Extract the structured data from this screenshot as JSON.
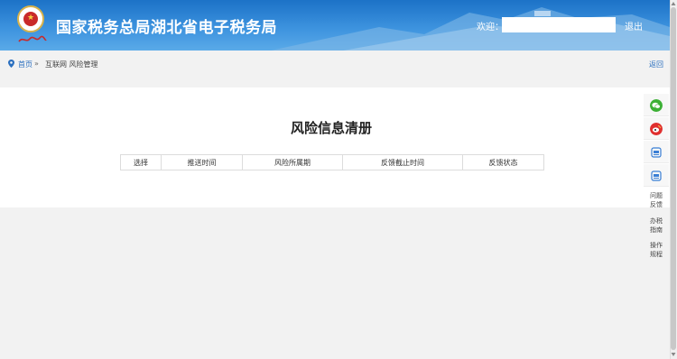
{
  "header": {
    "title": "国家税务总局湖北省电子税务局",
    "welcome_label": "欢迎：",
    "logout_label": "退出",
    "emblem_text": "中国税务"
  },
  "breadcrumb": {
    "home_label": "首页",
    "separator": "»",
    "current": "互联网 风险管理",
    "back_label": "返回"
  },
  "main": {
    "title": "风险信息清册",
    "table": {
      "columns": [
        "选择",
        "推送时间",
        "风险所属期",
        "反馈截止时间",
        "反馈状态"
      ]
    }
  },
  "side_toolbar": {
    "items": [
      {
        "name": "wechat",
        "color": "#3cb035"
      },
      {
        "name": "weibo",
        "color": "#e0302f"
      },
      {
        "name": "app-1",
        "color": "#3a7fd5"
      },
      {
        "name": "app-2",
        "color": "#3a7fd5"
      }
    ],
    "text_links": [
      "问题\n反馈",
      "办税\n指南",
      "操作\n规程"
    ]
  },
  "colors": {
    "header_blue": "#2b82d6",
    "link_blue": "#2a6fbf"
  }
}
